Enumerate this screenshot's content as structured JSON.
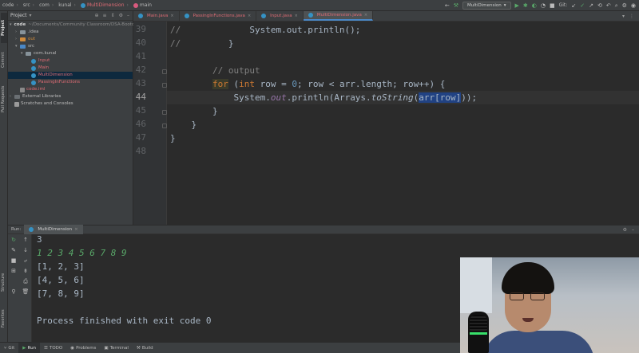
{
  "breadcrumbs": [
    "code",
    "src",
    "com",
    "kunal",
    "MultiDimension",
    "main"
  ],
  "toolbar": {
    "run_config": "MultiDimension",
    "git_label": "Git:",
    "icons": [
      "hammer-icon",
      "run-icon",
      "debug-icon",
      "coverage-icon",
      "stop-icon",
      "search-icon",
      "gear-icon",
      "avatar-icon"
    ]
  },
  "left_stripe": {
    "tabs": [
      "Project",
      "Commit",
      "Pull Requests",
      "Structure",
      "Favorites"
    ]
  },
  "project": {
    "title": "Project",
    "tree": [
      {
        "label": "code",
        "note": "~/Documents/Community Classroom/DSA-Bootcamp-Java/...",
        "depth": 0,
        "kind": "folder"
      },
      {
        "label": ".idea",
        "depth": 1,
        "kind": "folder"
      },
      {
        "label": "out",
        "depth": 1,
        "kind": "folder-orange"
      },
      {
        "label": "src",
        "depth": 1,
        "kind": "folder-blue"
      },
      {
        "label": "com.kunal",
        "depth": 2,
        "kind": "package"
      },
      {
        "label": "Input",
        "depth": 3,
        "kind": "class"
      },
      {
        "label": "Main",
        "depth": 3,
        "kind": "class"
      },
      {
        "label": "MultiDimension",
        "depth": 3,
        "kind": "class",
        "selected": true
      },
      {
        "label": "PassingInFunctions",
        "depth": 3,
        "kind": "class"
      },
      {
        "label": "code.iml",
        "depth": 1,
        "kind": "file"
      },
      {
        "label": "External Libraries",
        "depth": 0,
        "kind": "lib"
      },
      {
        "label": "Scratches and Consoles",
        "depth": 0,
        "kind": "scratch"
      }
    ]
  },
  "editor_tabs": [
    {
      "label": "Main.java",
      "active": false
    },
    {
      "label": "PassingInFunctions.java",
      "active": false
    },
    {
      "label": "Input.java",
      "active": false
    },
    {
      "label": "MultiDimension.java",
      "active": true
    }
  ],
  "editor": {
    "line_numbers": [
      "39",
      "40",
      "41",
      "42",
      "43",
      "44",
      "45",
      "46",
      "47",
      "48"
    ],
    "active_line": "44",
    "lines": {
      "l39_comment": "//",
      "l39_code": "System.out.println();",
      "l40_comment": "//",
      "l40_code": "}",
      "l42_comment": "// output",
      "l43_for": "for",
      "l43_paren": " (",
      "l43_int": "int",
      "l43_rest_a": " row = ",
      "l43_zero": "0",
      "l43_rest_b": "; row < arr.length; row++) {",
      "l44_a": "System.",
      "l44_out": "out",
      "l44_b": ".println(Arrays.",
      "l44_tostring": "toString",
      "l44_c": "(",
      "l44_sel": "arr[row]",
      "l44_d": "));",
      "l45": "}",
      "l46": "}",
      "l47": "}"
    }
  },
  "run": {
    "label": "Run:",
    "tab": "MultiDimension",
    "console": [
      {
        "text": "3",
        "input": false
      },
      {
        "text": "1 2 3 4 5 6 7 8 9",
        "input": true
      },
      {
        "text": "[1, 2, 3]",
        "input": false
      },
      {
        "text": "[4, 5, 6]",
        "input": false
      },
      {
        "text": "[7, 8, 9]",
        "input": false
      },
      {
        "text": "",
        "input": false
      },
      {
        "text": "Process finished with exit code 0",
        "input": false
      }
    ]
  },
  "bottom_tabs": [
    "Git",
    "Run",
    "TODO",
    "Problems",
    "Terminal",
    "Build"
  ],
  "colors": {
    "keyword": "#cc7832",
    "comment": "#808080",
    "number": "#6897bb",
    "field": "#9876aa",
    "input_text": "#59a869",
    "selection": "#214283"
  }
}
